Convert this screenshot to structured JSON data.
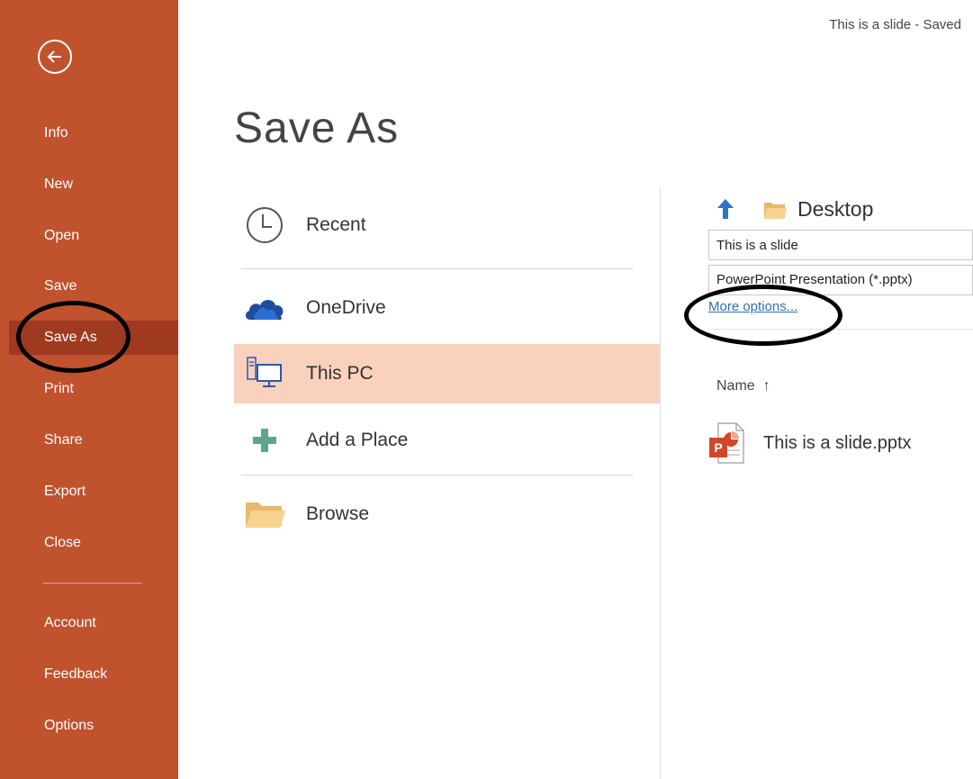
{
  "window": {
    "doc_status": "This is a slide  -  Saved"
  },
  "rail": {
    "back_icon": "back-arrow-circle-icon",
    "items": [
      {
        "label": "Info"
      },
      {
        "label": "New"
      },
      {
        "label": "Open"
      },
      {
        "label": "Save"
      },
      {
        "label": "Save As",
        "selected": true
      },
      {
        "label": "Print"
      },
      {
        "label": "Share"
      },
      {
        "label": "Export"
      },
      {
        "label": "Close"
      },
      {
        "label": "Account"
      },
      {
        "label": "Feedback"
      },
      {
        "label": "Options"
      }
    ]
  },
  "main": {
    "title": "Save As",
    "places": [
      {
        "label": "Recent",
        "icon": "clock-icon"
      },
      {
        "label": "OneDrive",
        "icon": "onedrive-cloud-icon"
      },
      {
        "label": "This PC",
        "icon": "computer-icon",
        "selected": true
      },
      {
        "label": "Add a Place",
        "icon": "plus-icon"
      },
      {
        "label": "Browse",
        "icon": "folder-icon"
      }
    ]
  },
  "save_pane": {
    "location": "Desktop",
    "filename": "This is a slide",
    "file_type": "PowerPoint Presentation (*.pptx)",
    "more_options": "More options...",
    "column_name": "Name",
    "sort_indicator": "↑",
    "files": [
      {
        "name": "This is a slide.pptx",
        "icon": "powerpoint-file-icon"
      }
    ]
  },
  "colors": {
    "rail": "#c0522e",
    "rail_selected": "#9f3a20",
    "place_selected": "#f9d1bd",
    "link": "#2f6fb7",
    "annotation": "#000000"
  }
}
